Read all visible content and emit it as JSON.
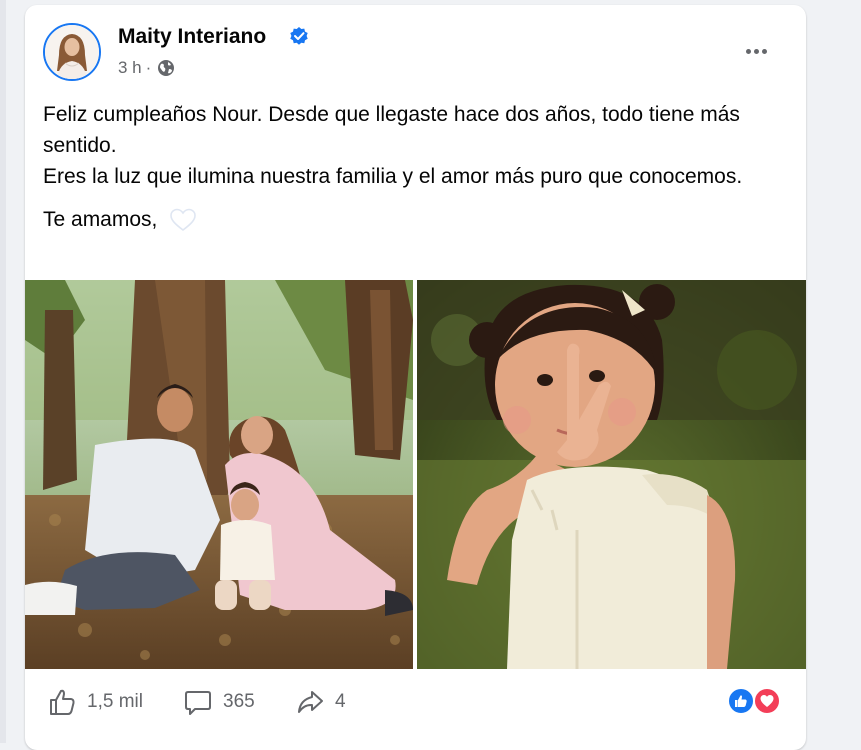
{
  "post": {
    "author": "Maity Interiano",
    "time": "3 h",
    "separator": "·",
    "text_line_1": "Feliz cumpleaños Nour. Desde que llegaste hace dos años, todo tiene más sentido.",
    "text_line_2": "Eres la luz que ilumina nuestra familia y el amor más puro que conocemos.",
    "text_line_3": "Te amamos,"
  },
  "stats": {
    "likes": "1,5 mil",
    "comments": "365",
    "shares": "4"
  },
  "icons": {
    "verified": "verified-badge-icon",
    "audience": "globe-icon",
    "more": "more-options-icon",
    "like": "thumbs-up-icon",
    "comment": "comment-bubble-icon",
    "share": "share-arrow-icon",
    "heart": "white-heart-icon",
    "reaction_like": "like-reaction-icon",
    "reaction_love": "love-reaction-icon"
  },
  "colors": {
    "accent": "#1877f2",
    "love": "#f33e58",
    "secondary_text": "#65676b",
    "background": "#f0f2f5"
  }
}
